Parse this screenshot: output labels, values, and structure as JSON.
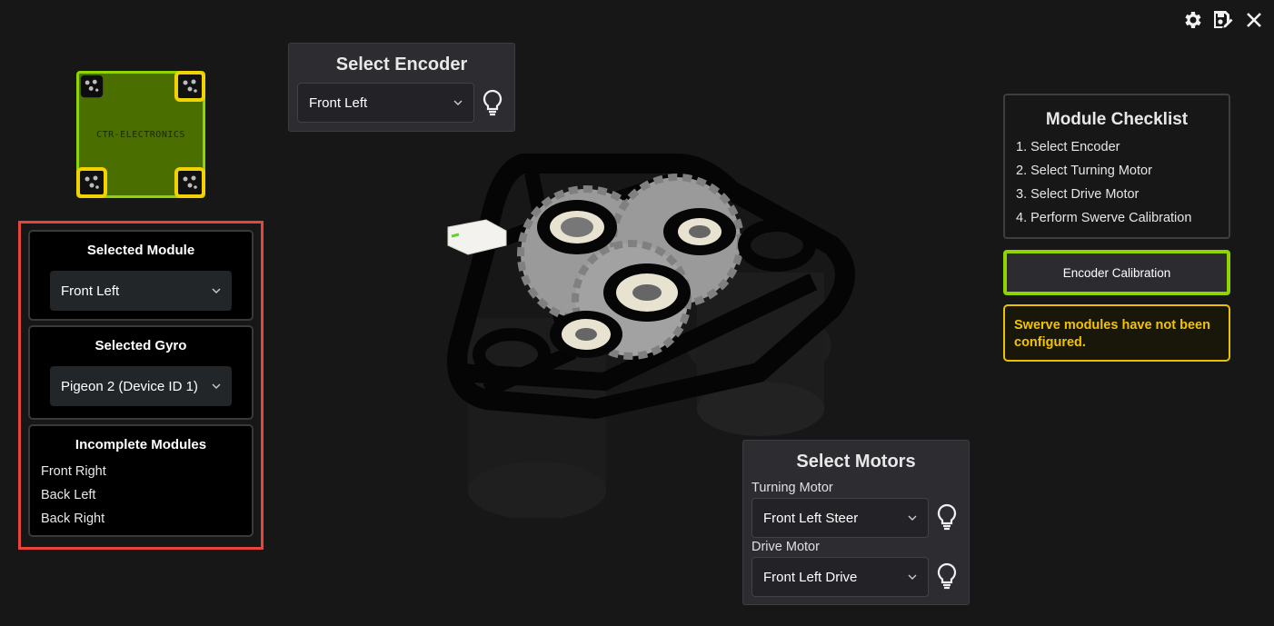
{
  "window_controls": {
    "settings_icon": "gear-icon",
    "save_icon": "save-edit-icon",
    "close_icon": "close-icon"
  },
  "chassis": {
    "brand_text": "CTR-ELECTRONICS",
    "highlight_color": "#f2d200",
    "body_color": "#4a6e00"
  },
  "left_panel": {
    "border_color": "#e5453b",
    "selected_module": {
      "title": "Selected Module",
      "value": "Front Left"
    },
    "selected_gyro": {
      "title": "Selected Gyro",
      "value": "Pigeon 2 (Device ID 1)"
    },
    "incomplete_modules": {
      "title": "Incomplete Modules",
      "items": [
        "Front Right",
        "Back Left",
        "Back Right"
      ]
    }
  },
  "encoder": {
    "title": "Select Encoder",
    "value": "Front Left"
  },
  "motors": {
    "title": "Select Motors",
    "turning_label": "Turning Motor",
    "turning_value": "Front Left Steer",
    "drive_label": "Drive Motor",
    "drive_value": "Front Left Drive"
  },
  "checklist": {
    "title": "Module Checklist",
    "items": [
      "1. Select Encoder",
      "2. Select Turning Motor",
      "3. Select Drive Motor",
      "4. Perform Swerve Calibration"
    ]
  },
  "calibration_button": {
    "label": "Encoder Calibration",
    "accent": "#8fd400"
  },
  "warning": {
    "text": "Swerve modules have not been configured.",
    "color": "#f2c400"
  }
}
